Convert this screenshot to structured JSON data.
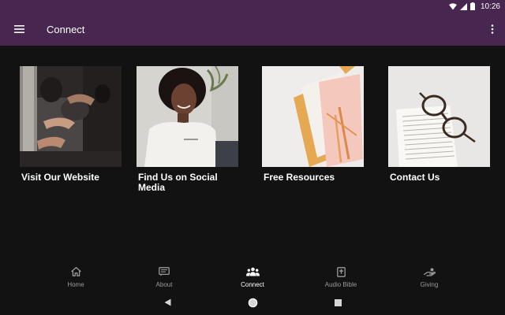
{
  "status_bar": {
    "time": "10:26",
    "icons": [
      "wifi-icon",
      "cell-signal-icon",
      "battery-icon"
    ]
  },
  "app_bar": {
    "title": "Connect",
    "menu_icon": "hamburger-menu-icon",
    "overflow_icon": "more-vert-icon"
  },
  "cards": [
    {
      "label": "Visit Our Website",
      "image": "worship-crowd-photo"
    },
    {
      "label": "Find Us on Social Media",
      "image": "smiling-woman-photo"
    },
    {
      "label": "Free Resources",
      "image": "paper-pens-photo"
    },
    {
      "label": "Contact Us",
      "image": "glasses-on-book-photo"
    }
  ],
  "bottom_nav": {
    "active": "Connect",
    "items": [
      {
        "label": "Home",
        "icon": "home-icon"
      },
      {
        "label": "About",
        "icon": "message-icon"
      },
      {
        "label": "Connect",
        "icon": "people-icon"
      },
      {
        "label": "Audio Bible",
        "icon": "bible-icon"
      },
      {
        "label": "Giving",
        "icon": "giving-hand-icon"
      }
    ]
  },
  "system_nav": {
    "icons": [
      "back-icon",
      "home-circle-icon",
      "recents-icon"
    ]
  },
  "colors": {
    "brand": "#47264f",
    "background": "#121212",
    "text": "#ffffff",
    "inactive": "#9a9a9a"
  }
}
